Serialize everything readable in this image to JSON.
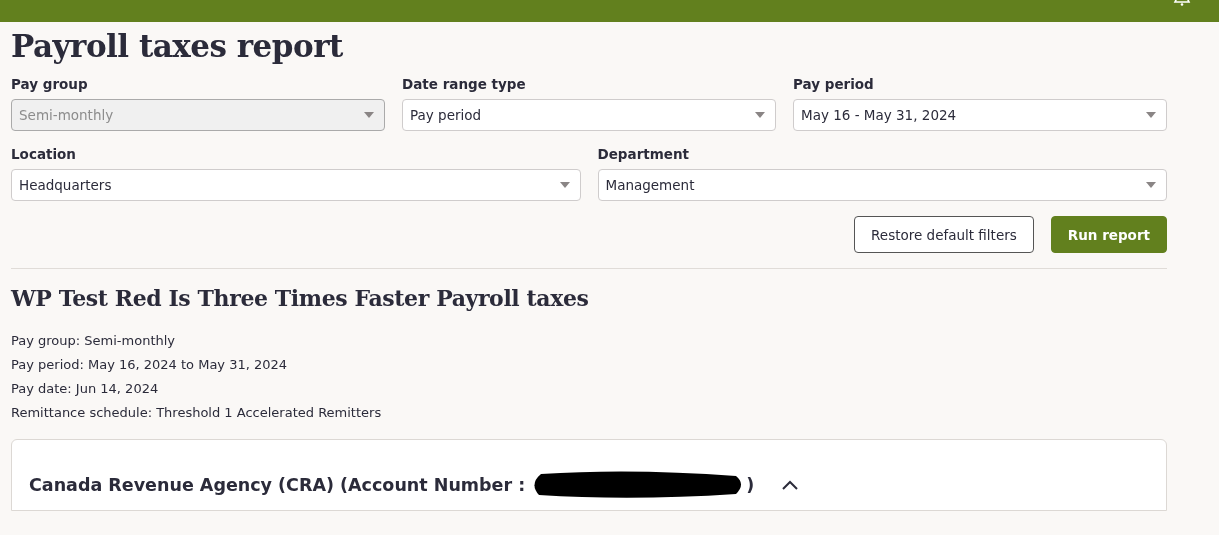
{
  "page": {
    "title": "Payroll taxes report"
  },
  "filter_rows": [
    [
      {
        "label": "Pay group",
        "value": "Semi-monthly",
        "disabled": true
      },
      {
        "label": "Date range type",
        "value": "Pay period",
        "disabled": false
      },
      {
        "label": "Pay period",
        "value": "May 16 - May 31, 2024",
        "disabled": false
      }
    ],
    [
      {
        "label": "Location",
        "value": "Headquarters",
        "disabled": false
      },
      {
        "label": "Department",
        "value": "Management",
        "disabled": false
      }
    ]
  ],
  "actions": [
    {
      "label": "Restore default filters",
      "kind": "secondary"
    },
    {
      "label": "Run report",
      "kind": "primary"
    }
  ],
  "report": {
    "title": "WP Test Red Is Three Times Faster Payroll taxes",
    "details": [
      "Pay group: Semi-monthly",
      "Pay period: May 16, 2024 to May 31, 2024",
      "Pay date: Jun 14, 2024",
      "Remittance schedule: Threshold 1 Accelerated Remitters"
    ]
  },
  "agency_section": {
    "title_start": "Canada Revenue Agency (CRA) (Account Number :",
    "title_end": ")",
    "redacted": true,
    "expanded": true
  }
}
